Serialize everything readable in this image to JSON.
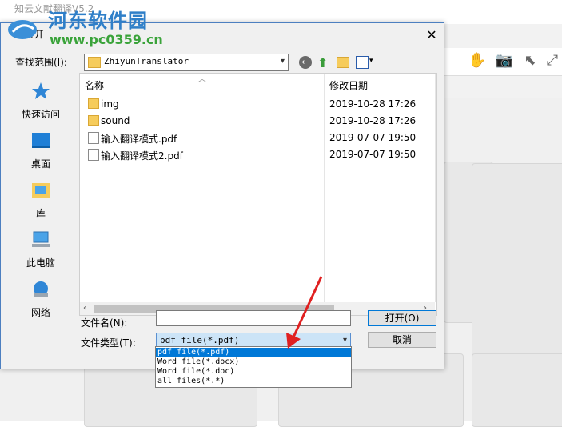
{
  "app": {
    "title": "知云文献翻译V5.2"
  },
  "watermark": {
    "title": "河东软件园",
    "url": "www.pc0359.cn"
  },
  "dialog": {
    "title": "打开",
    "close": "✕",
    "look_in_label": "查找范围(I):",
    "look_in_value": "ZhiyunTranslator",
    "places": [
      {
        "label": "快速访问",
        "icon": "star-icon"
      },
      {
        "label": "桌面",
        "icon": "desktop-icon"
      },
      {
        "label": "库",
        "icon": "library-icon"
      },
      {
        "label": "此电脑",
        "icon": "computer-icon"
      },
      {
        "label": "网络",
        "icon": "network-icon"
      }
    ],
    "columns": {
      "name": "名称",
      "date": "修改日期"
    },
    "files": [
      {
        "name": "img",
        "date": "2019-10-28 17:26",
        "type": "folder"
      },
      {
        "name": "sound",
        "date": "2019-10-28 17:26",
        "type": "folder"
      },
      {
        "name": "输入翻译模式.pdf",
        "date": "2019-07-07 19:50",
        "type": "pdf"
      },
      {
        "name": "输入翻译模式2.pdf",
        "date": "2019-07-07 19:50",
        "type": "pdf"
      }
    ],
    "filename_label": "文件名(N):",
    "filename_value": "",
    "filetype_label": "文件类型(T):",
    "filetype_value": "pdf file(*.pdf)",
    "filetype_options": [
      "pdf file(*.pdf)",
      "Word file(*.docx)",
      "Word file(*.doc)",
      "all files(*.*)"
    ],
    "open_button": "打开(O)",
    "cancel_button": "取消"
  },
  "colors": {
    "accent": "#0078d7",
    "annotation": "#e02020",
    "watermark_blue": "#2f7fc8",
    "watermark_green": "#3aa33a"
  }
}
